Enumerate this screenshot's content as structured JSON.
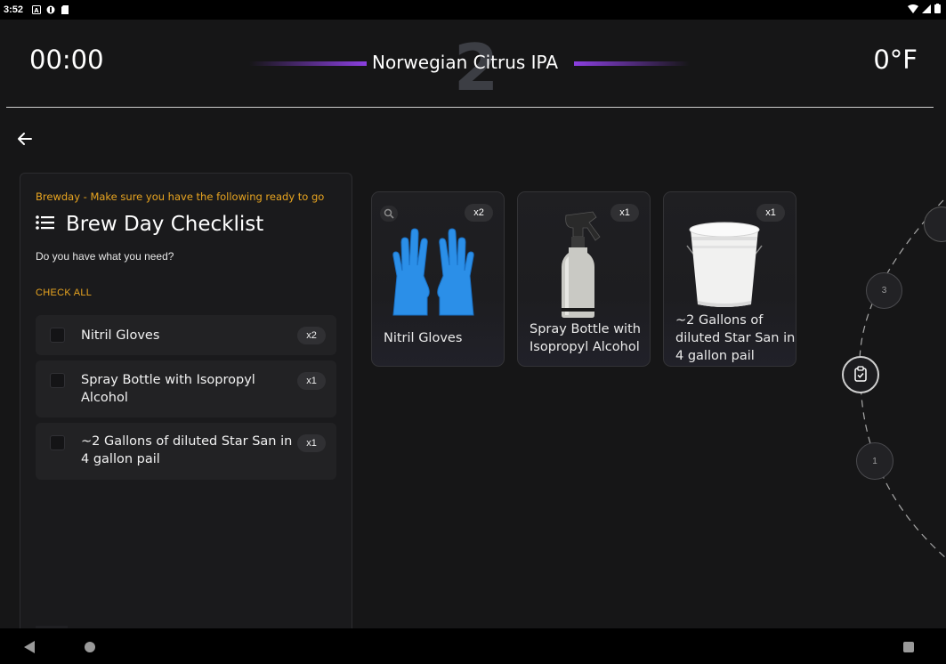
{
  "status_bar": {
    "time": "3:52"
  },
  "header": {
    "timer": "00:00",
    "step_number": "2",
    "beer_name": "Norwegian Citrus IPA",
    "temperature": "0°F"
  },
  "checklist": {
    "subtitle": "Brewday - Make sure you have the following ready to go",
    "title": "Brew Day Checklist",
    "question": "Do you have what you need?",
    "check_all": "CHECK ALL",
    "items": [
      {
        "label": "Nitril Gloves",
        "qty": "x2"
      },
      {
        "label": "Spray Bottle with Isopropyl Alcohol",
        "qty": "x1"
      },
      {
        "label": "~2 Gallons of diluted Star San in 4 gallon pail",
        "qty": "x1"
      }
    ]
  },
  "cards": [
    {
      "name": "Nitril Gloves",
      "qty": "x2"
    },
    {
      "name": "Spray Bottle with Isopropyl Alcohol",
      "qty": "x1"
    },
    {
      "name": "~2 Gallons of diluted Star San in 4 gallon pail",
      "qty": "x1"
    }
  ],
  "steps": {
    "upper": "3",
    "lower": "1"
  },
  "colors": {
    "accent": "#e9a520",
    "purple": "#8b3fe0",
    "background": "#161617"
  }
}
